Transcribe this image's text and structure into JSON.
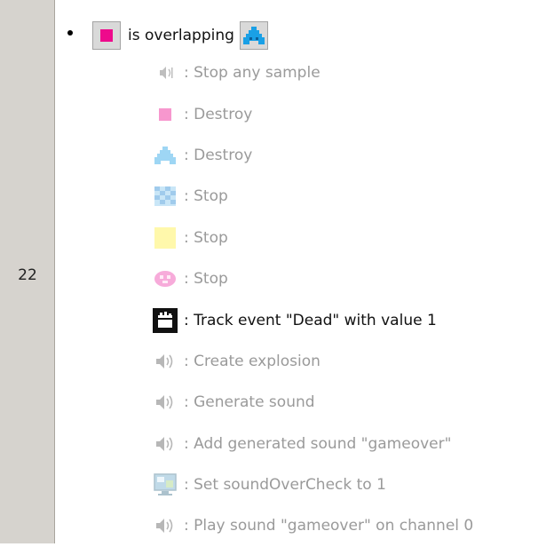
{
  "event": {
    "line_number": "22",
    "condition_text": "is overlapping"
  },
  "actions": [
    {
      "icon": "speaker-small-icon",
      "label": ": Stop any sample",
      "active": false
    },
    {
      "icon": "pink-square-icon",
      "label": ": Destroy",
      "active": false
    },
    {
      "icon": "blue-invader-icon",
      "label": ": Destroy",
      "active": false
    },
    {
      "icon": "checkered-blue-icon",
      "label": ": Stop",
      "active": false
    },
    {
      "icon": "yellow-square-icon",
      "label": ": Stop",
      "active": false
    },
    {
      "icon": "pink-blob-icon",
      "label": ": Stop",
      "active": false
    },
    {
      "icon": "analytics-clapper-icon",
      "label": ": Track event \"Dead\" with value 1",
      "active": true
    },
    {
      "icon": "speaker-icon",
      "label": ": Create explosion",
      "active": false
    },
    {
      "icon": "speaker-icon",
      "label": ": Generate sound",
      "active": false
    },
    {
      "icon": "speaker-icon",
      "label": ": Add generated sound \"gameover\"",
      "active": false
    },
    {
      "icon": "monitor-icon",
      "label": ": Set soundOverCheck to 1",
      "active": false
    },
    {
      "icon": "speaker-icon",
      "label": ": Play sound \"gameover\" on channel 0",
      "active": false
    }
  ],
  "colors": {
    "pink": "#ee0a8c",
    "blue": "#1aa0e6",
    "disabled_text": "#9a9a9a",
    "gutter": "#d6d3ce"
  }
}
